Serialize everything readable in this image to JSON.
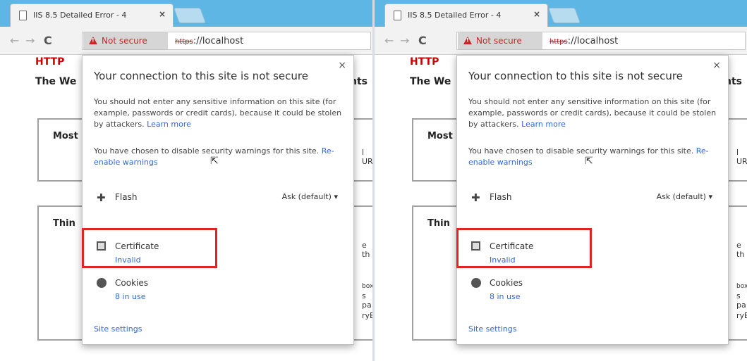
{
  "browser": {
    "tab": {
      "title": "IIS 8.5 Detailed Error - 4",
      "close": "×"
    },
    "toolbar": {
      "back": "←",
      "forward": "→",
      "reload": "C"
    },
    "address_bar": {
      "security_label": "Not secure",
      "scheme": "https",
      "rest": "://localhost"
    }
  },
  "page": {
    "heading": "HTTP",
    "subheading": "The We",
    "subheading_tail": "nts",
    "box1": {
      "title": "Most",
      "tail": "l UR"
    },
    "box2": {
      "title": "Thin",
      "tail_lines": [
        "e th",
        "box",
        "s pa",
        "ryB"
      ]
    }
  },
  "popup": {
    "close": "×",
    "title": "Your connection to this site is not secure",
    "warning_text": "You should not enter any sensitive information on this site (for example, passwords or credit cards), because it could be stolen by attackers.",
    "learn_more": "Learn more",
    "disabled_text": "You have chosen to disable security warnings for this site.",
    "reenable_link": "Re-enable warnings",
    "flash": {
      "label": "Flash",
      "value": "Ask (default) ▾",
      "icon": "puzzle-icon"
    },
    "certificate": {
      "label": "Certificate",
      "status": "Invalid",
      "icon": "certificate-icon"
    },
    "cookies": {
      "label": "Cookies",
      "status": "8 in use",
      "icon": "cookie-icon"
    },
    "site_settings": "Site settings"
  },
  "colors": {
    "tabstrip": "#5eb6e4",
    "warning_red": "#c62828",
    "link_blue": "#3367d6",
    "highlight_red": "#e02424"
  }
}
